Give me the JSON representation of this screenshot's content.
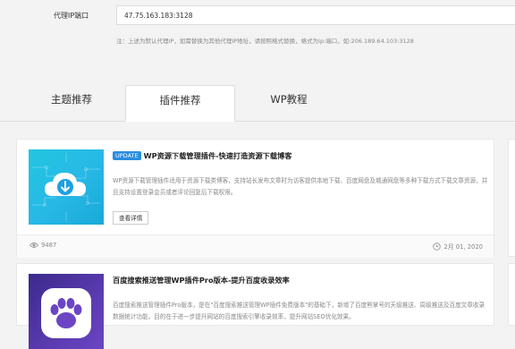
{
  "proxy": {
    "label": "代理IP端口",
    "value": "47.75.163.183:3128",
    "note": "注：上述为默认代理IP，如需替换为其他代理IP地址，请按照格式替换，格式为ip:端口，如:206.189.64.103:3128"
  },
  "tabs": [
    {
      "label": "主题推荐",
      "active": false
    },
    {
      "label": "插件推荐",
      "active": true
    },
    {
      "label": "WP教程",
      "active": false
    }
  ],
  "cards": [
    {
      "badge": "UPDATE",
      "title": "WP资源下载管理插件-快速打造资源下载博客",
      "desc": "WP资源下载管理插件适用于资源下载类博客，支持站长发布文章时为访客提供本地下载、百度网盘及城通网盘等多种下载方式下载文章资源，并且支持设置登录会员或者评论回复后下载权限。",
      "button": "查看详情",
      "views": "9487",
      "date": "2月 01, 2020",
      "thumb_icon": "cloud-download-icon"
    },
    {
      "title": "百度搜索推送管理WP插件Pro版本-提升百度收录效率",
      "desc": "百度搜索推送管理插件Pro版本，是在\"百度搜索推送管理WP插件免费版本\"的基础下，新增了百度熊掌号的天级推送、周级推送及百度文章收录数据统计功能，目的在于进一步提升网站的百度搜索引擎收录效率，提升网站SEO优化效果。",
      "thumb_icon": "paw-icon"
    }
  ]
}
